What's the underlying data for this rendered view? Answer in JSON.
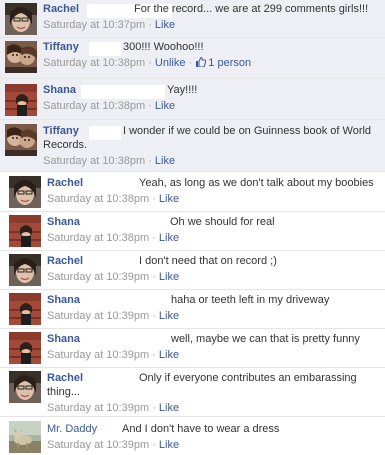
{
  "comments": [
    {
      "author": "Rachel",
      "text": "For the record... we are at 299 comments girls!!!",
      "time": "Saturday at 10:37pm",
      "sep": "·",
      "like": "Like"
    },
    {
      "author": "Tiffany",
      "text": "300!!! Woohoo!!!",
      "time": "Saturday at 10:38pm",
      "sep": "·",
      "unlike": "Unlike",
      "sep2": "·",
      "likes_count": "1 person"
    },
    {
      "author": "Shana",
      "text": "Yay!!!!",
      "time": "Saturday at 10:38pm",
      "sep": "·",
      "like": "Like"
    },
    {
      "author": "Tiffany",
      "text_line1": "I wonder if we could be on Guinness book of World",
      "text_line2": "Records.",
      "time": "Saturday at 10:38pm",
      "sep": "·",
      "like": "Like"
    },
    {
      "author": "Rachel",
      "text": "Yeah, as long as we don't talk about my boobies",
      "time": "Saturday at 10:38pm",
      "sep": "·",
      "like": "Like"
    },
    {
      "author": "Shana",
      "text": "Oh we should for real",
      "time": "Saturday at 10:38pm",
      "sep": "·",
      "like": "Like"
    },
    {
      "author": "Rachel",
      "text": "I don't need that on record ;)",
      "time": "Saturday at 10:39pm",
      "sep": "·",
      "like": "Like"
    },
    {
      "author": "Shana",
      "text": "haha or teeth left in my driveway",
      "time": "Saturday at 10:39pm",
      "sep": "·",
      "like": "Like"
    },
    {
      "author": "Shana",
      "text": "well, maybe we can that is pretty funny",
      "time": "Saturday at 10:39pm",
      "sep": "·",
      "like": "Like"
    },
    {
      "author": "Rachel",
      "text_line1": "Only if everyone contributes an embarassing",
      "text_line2": "thing...",
      "time": "Saturday at 10:39pm",
      "sep": "·",
      "like": "Like"
    },
    {
      "author": "Mr. Daddy",
      "text": "And I don't have to wear a dress",
      "time": "Saturday at 10:39pm",
      "sep": "·",
      "like": "Like"
    }
  ],
  "colors": {
    "link": "#3b5998",
    "meta": "#999999",
    "shaded_bg": "#edeff4"
  },
  "icons": {
    "like_count": "thumbs-up-icon"
  }
}
